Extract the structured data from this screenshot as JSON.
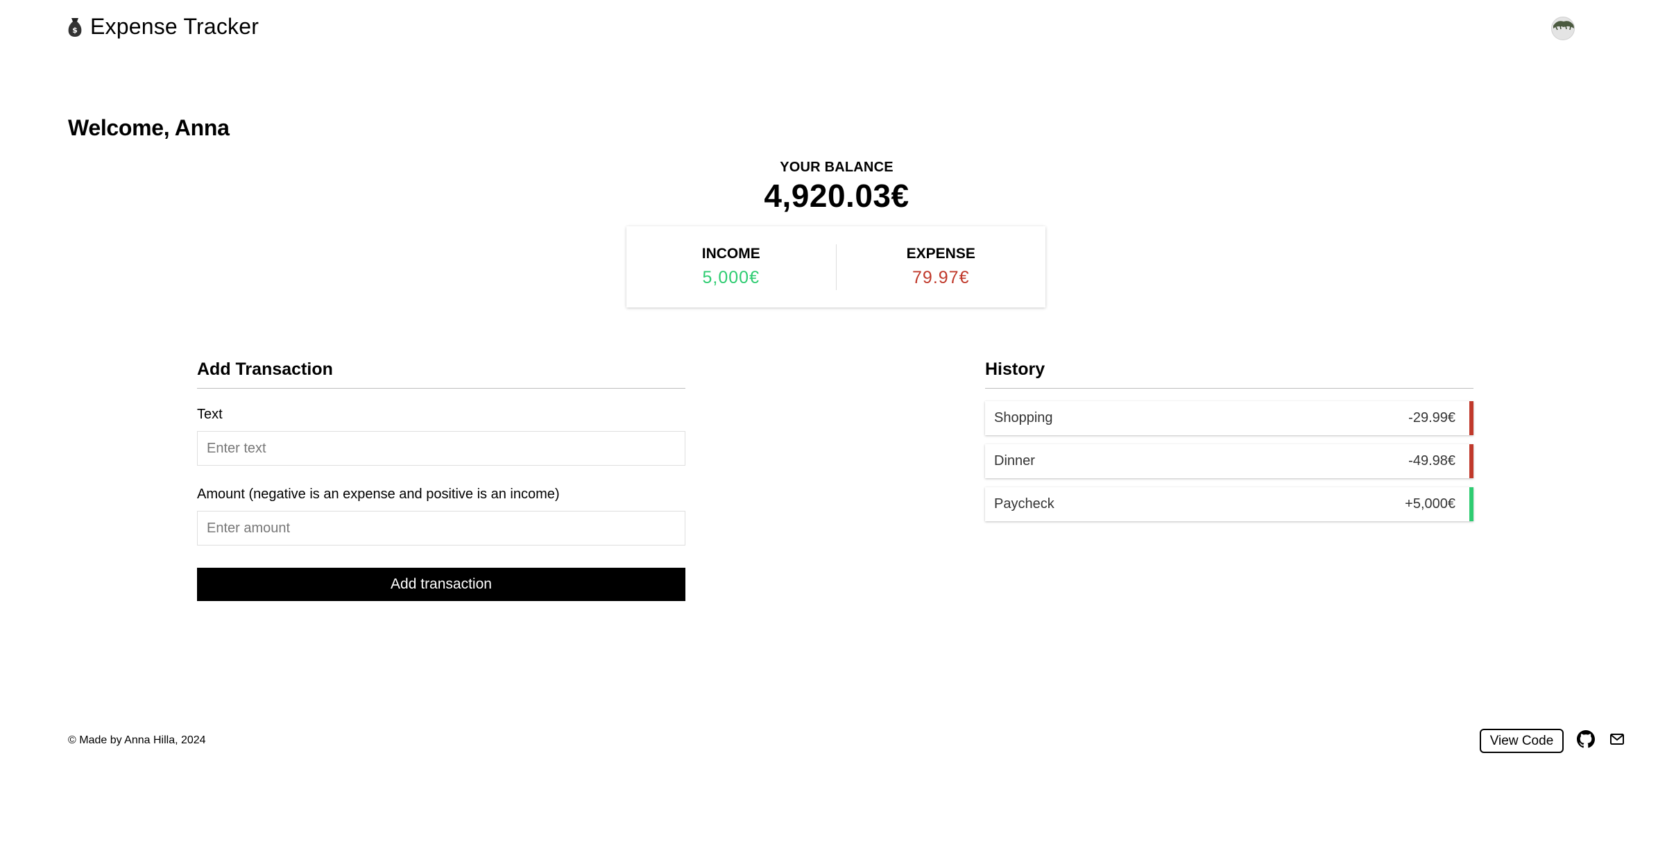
{
  "header": {
    "title": "Expense Tracker",
    "logo_icon": "money-bag-icon",
    "avatar_icon": "avatar-plant-icon"
  },
  "welcome": "Welcome, Anna",
  "balance": {
    "label": "YOUR BALANCE",
    "value": "4,920.03€"
  },
  "summary": {
    "income_label": "INCOME",
    "income_value": "5,000€",
    "expense_label": "EXPENSE",
    "expense_value": "79.97€",
    "income_color": "#2ecc71",
    "expense_color": "#c0392b"
  },
  "add_transaction": {
    "title": "Add Transaction",
    "text_label": "Text",
    "text_placeholder": "Enter text",
    "amount_label": "Amount (negative is an expense and positive is an income)",
    "amount_placeholder": "Enter amount",
    "button_label": "Add transaction"
  },
  "history": {
    "title": "History",
    "items": [
      {
        "text": "Shopping",
        "amount": "-29.99€",
        "kind": "minus"
      },
      {
        "text": "Dinner",
        "amount": "-49.98€",
        "kind": "minus"
      },
      {
        "text": "Paycheck",
        "amount": "+5,000€",
        "kind": "plus"
      }
    ]
  },
  "footer": {
    "copyright": "© Made by Anna Hilla, 2024",
    "view_code_label": "View Code",
    "github_icon": "github-icon",
    "mail_icon": "mail-icon"
  }
}
